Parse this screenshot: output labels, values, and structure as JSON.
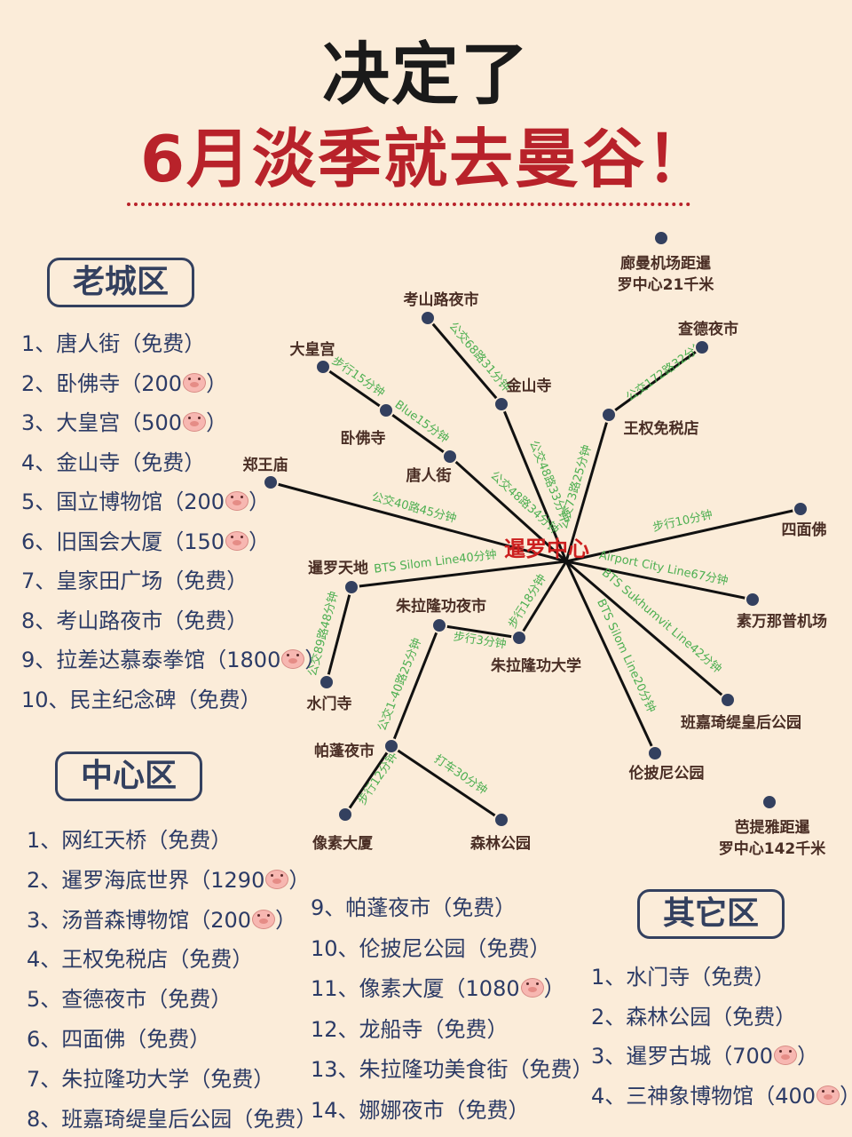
{
  "header": {
    "title_line1": "决定了",
    "title_line2": "6月淡季就去曼谷！"
  },
  "colors": {
    "background": "#fbecd9",
    "accent_red": "#b8222a",
    "navy": "#2c3b66",
    "route_green": "#4caf50"
  },
  "sections": {
    "old_city": {
      "title": "老城区",
      "items": [
        {
          "text": "1、唐人街（免费）",
          "pig": false
        },
        {
          "text": "2、卧佛寺（200",
          "pig": true,
          "suffix": "）"
        },
        {
          "text": "3、大皇宫（500",
          "pig": true,
          "suffix": "）"
        },
        {
          "text": "4、金山寺（免费）",
          "pig": false
        },
        {
          "text": "5、国立博物馆（200",
          "pig": true,
          "suffix": "）"
        },
        {
          "text": "6、旧国会大厦（150",
          "pig": true,
          "suffix": "）"
        },
        {
          "text": "7、皇家田广场（免费）",
          "pig": false
        },
        {
          "text": "8、考山路夜市（免费）",
          "pig": false
        },
        {
          "text": "9、拉差达慕泰拳馆（1800",
          "pig": true,
          "suffix": "）"
        },
        {
          "text": "10、民主纪念碑（免费）",
          "pig": false
        }
      ]
    },
    "center": {
      "title": "中心区",
      "items": [
        {
          "text": "1、网红天桥（免费）",
          "pig": false
        },
        {
          "text": "2、暹罗海底世界（1290",
          "pig": true,
          "suffix": "）"
        },
        {
          "text": "3、汤普森博物馆（200",
          "pig": true,
          "suffix": "）"
        },
        {
          "text": "4、王权免税店（免费）",
          "pig": false
        },
        {
          "text": "5、查德夜市（免费）",
          "pig": false
        },
        {
          "text": "6、四面佛（免费）",
          "pig": false
        },
        {
          "text": "7、朱拉隆功大学（免费）",
          "pig": false
        },
        {
          "text": "8、班嘉琦缇皇后公园（免费）",
          "pig": false
        }
      ],
      "items_col2": [
        {
          "text": "9、帕蓬夜市（免费）",
          "pig": false
        },
        {
          "text": "10、伦披尼公园（免费）",
          "pig": false
        },
        {
          "text": "11、像素大厦（1080",
          "pig": true,
          "suffix": "）"
        },
        {
          "text": "12、龙船寺（免费）",
          "pig": false
        },
        {
          "text": "13、朱拉隆功美食街（免费）",
          "pig": false
        },
        {
          "text": "14、娜娜夜市（免费）",
          "pig": false
        }
      ]
    },
    "other": {
      "title": "其它区",
      "items": [
        {
          "text": "1、水门寺（免费）",
          "pig": false
        },
        {
          "text": "2、森林公园（免费）",
          "pig": false
        },
        {
          "text": "3、暹罗古城（700",
          "pig": true,
          "suffix": "）"
        },
        {
          "text": "4、三神象博物馆（400",
          "pig": true,
          "suffix": "）"
        }
      ]
    }
  },
  "map": {
    "center": {
      "id": "siam",
      "label": "暹罗中心"
    },
    "nodes": [
      {
        "id": "airport_dmk",
        "label": "廊曼机场距暹\n罗中心21千米"
      },
      {
        "id": "khaosan",
        "label": "考山路夜市"
      },
      {
        "id": "golden_mount",
        "label": "金山寺"
      },
      {
        "id": "grand_palace",
        "label": "大皇宫"
      },
      {
        "id": "wat_pho",
        "label": "卧佛寺"
      },
      {
        "id": "chinatown",
        "label": "唐人街"
      },
      {
        "id": "chatuchak",
        "label": "查德夜市"
      },
      {
        "id": "king_power",
        "label": "王权免税店"
      },
      {
        "id": "zheng_wang",
        "label": "郑王庙"
      },
      {
        "id": "erawan",
        "label": "四面佛"
      },
      {
        "id": "siam_paragon",
        "label": "暹罗天地"
      },
      {
        "id": "chula_night",
        "label": "朱拉隆功夜市"
      },
      {
        "id": "chula_uni",
        "label": "朱拉隆功大学"
      },
      {
        "id": "suvarnabhumi",
        "label": "素万那普机场"
      },
      {
        "id": "benjakitti",
        "label": "班嘉琦缇皇后公园"
      },
      {
        "id": "lumpini",
        "label": "伦披尼公园"
      },
      {
        "id": "wat_pratu",
        "label": "水门寺"
      },
      {
        "id": "patpong",
        "label": "帕蓬夜市"
      },
      {
        "id": "pixel",
        "label": "像素大厦"
      },
      {
        "id": "forest_park",
        "label": "森林公园"
      },
      {
        "id": "pattaya",
        "label": "芭提雅距暹\n罗中心142千米"
      }
    ],
    "edges": [
      {
        "id": "e_khaosan_golden",
        "label": "公交68路31分钟"
      },
      {
        "id": "e_golden_siam",
        "label": "公交48路33分钟"
      },
      {
        "id": "e_palace_pho",
        "label": "步行15分钟"
      },
      {
        "id": "e_pho_china",
        "label": "Blue15分钟"
      },
      {
        "id": "e_china_siam",
        "label": "公交48路34分钟"
      },
      {
        "id": "e_chatu_king",
        "label": "公交172路32分钟"
      },
      {
        "id": "e_king_siam",
        "label": "公交73路25分钟"
      },
      {
        "id": "e_zheng_siam",
        "label": "公交40路45分钟"
      },
      {
        "id": "e_siam_erawan",
        "label": "步行10分钟"
      },
      {
        "id": "e_paragon_siam",
        "label": "BTS Silom Line40分钟"
      },
      {
        "id": "e_siam_chula",
        "label": "步行18分钟"
      },
      {
        "id": "e_siam_suvarna",
        "label": "Airport City Line67分钟"
      },
      {
        "id": "e_siam_benja",
        "label": "BTS Sukhumvit Line42分钟"
      },
      {
        "id": "e_siam_lumpini",
        "label": "BTS Silom Line20分钟"
      },
      {
        "id": "e_paragon_pratu",
        "label": "公交89路48分钟"
      },
      {
        "id": "e_chulanight_uni",
        "label": "步行3分钟"
      },
      {
        "id": "e_chulanight_patpong",
        "label": "公交1-40路25分钟"
      },
      {
        "id": "e_patpong_pixel",
        "label": "步行12分钟"
      },
      {
        "id": "e_patpong_forest",
        "label": "打车30分钟"
      }
    ]
  }
}
